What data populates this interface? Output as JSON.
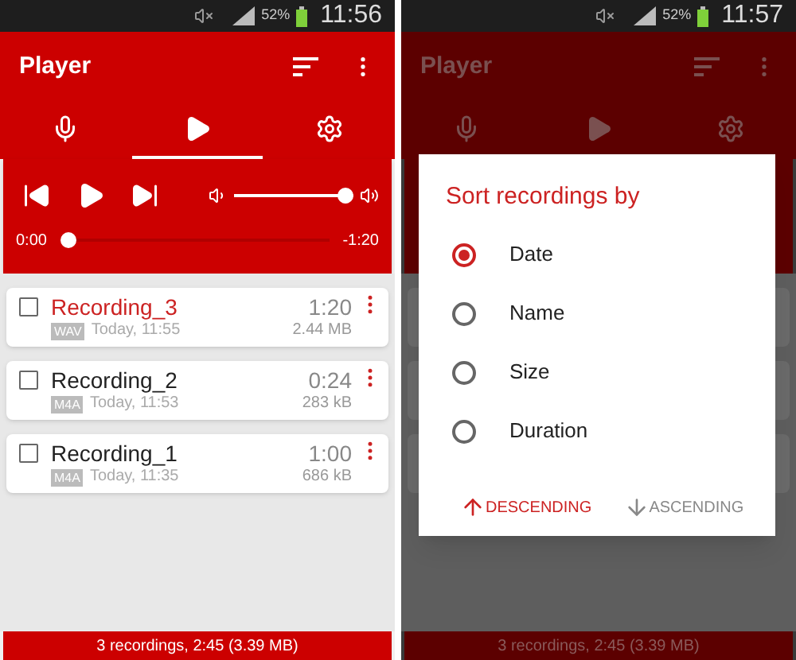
{
  "screens": [
    {
      "status_bar": {
        "battery": "52%",
        "time": "11:56"
      },
      "title": "Player",
      "dimmed": false,
      "tabs": [
        {
          "kind": "record",
          "selected": false
        },
        {
          "kind": "play",
          "selected": true
        },
        {
          "kind": "settings",
          "selected": false
        }
      ],
      "player": {
        "volume": {
          "level": 0.93
        },
        "position": {
          "level": 0.0
        },
        "elapsed": "0:00",
        "remaining": "-1:20"
      },
      "recordings": [
        {
          "name": "Recording_3",
          "playing": true,
          "checked": false,
          "format": "WAV",
          "date": "Today, 11:55",
          "duration": "1:20",
          "size": "2.44 MB"
        },
        {
          "name": "Recording_2",
          "playing": false,
          "checked": false,
          "format": "M4A",
          "date": "Today, 11:53",
          "duration": "0:24",
          "size": "283 kB"
        },
        {
          "name": "Recording_1",
          "playing": false,
          "checked": false,
          "format": "M4A",
          "date": "Today, 11:35",
          "duration": "1:00",
          "size": "686 kB"
        }
      ],
      "footer": "3 recordings, 2:45 (3.39 MB)"
    },
    {
      "status_bar": {
        "battery": "52%",
        "time": "11:57"
      },
      "title": "Player",
      "dimmed": true,
      "tabs": [
        {
          "kind": "record"
        },
        {
          "kind": "play"
        },
        {
          "kind": "settings"
        }
      ],
      "dialog": {
        "title": "Sort recordings by",
        "options": [
          {
            "label": "Date",
            "selected": true
          },
          {
            "label": "Name",
            "selected": false
          },
          {
            "label": "Size",
            "selected": false
          },
          {
            "label": "Duration",
            "selected": false
          }
        ],
        "buttons": [
          {
            "label": "DESCENDING",
            "kind": "up",
            "selected": true
          },
          {
            "label": "ASCENDING",
            "kind": "down",
            "selected": false
          }
        ]
      },
      "footer": "3 recordings, 2:45 (3.39 MB)"
    }
  ]
}
